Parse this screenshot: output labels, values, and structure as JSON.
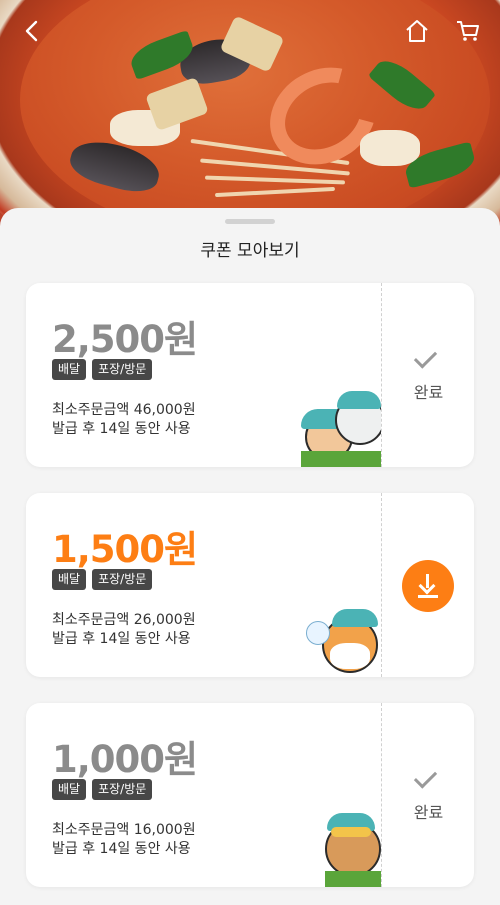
{
  "hero": {
    "back_icon": "arrow-left-icon",
    "home_icon": "home-icon",
    "cart_icon": "cart-icon"
  },
  "sheet": {
    "title": "쿠폰 모아보기"
  },
  "colors": {
    "accent": "#fd7e14",
    "used_amount": "#8b8b8b",
    "tag_bg": "#474747"
  },
  "coupons": [
    {
      "amount": "2,500원",
      "tags": [
        "배달",
        "포장/방문"
      ],
      "min_order": "최소주문금액 46,000원",
      "validity": "발급 후 14일 동안 사용",
      "status": "used",
      "status_label": "완료"
    },
    {
      "amount": "1,500원",
      "tags": [
        "배달",
        "포장/방문"
      ],
      "min_order": "최소주문금액 26,000원",
      "validity": "발급 후 14일 동안 사용",
      "status": "downloadable"
    },
    {
      "amount": "1,000원",
      "tags": [
        "배달",
        "포장/방문"
      ],
      "min_order": "최소주문금액 16,000원",
      "validity": "발급 후 14일 동안 사용",
      "status": "used",
      "status_label": "완료"
    }
  ]
}
